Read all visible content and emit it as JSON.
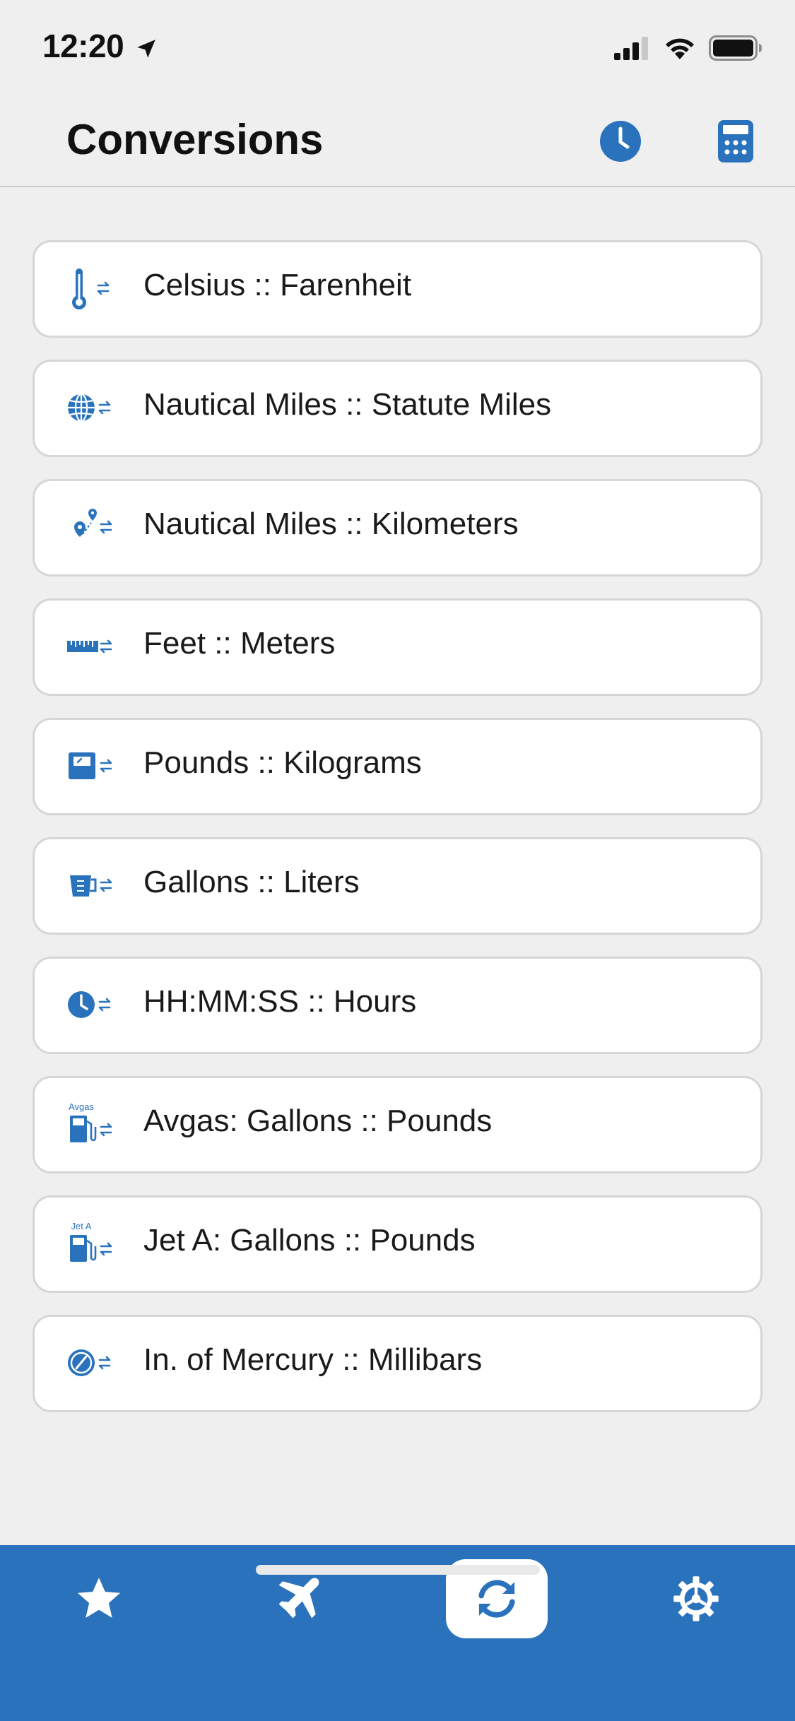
{
  "status_bar": {
    "time": "12:20",
    "icons": [
      "location-arrow-icon",
      "cellular-signal-icon",
      "wifi-icon",
      "battery-icon"
    ]
  },
  "header": {
    "title": "Conversions",
    "buttons": [
      {
        "name": "history",
        "icon": "clock-icon"
      },
      {
        "name": "calculator",
        "icon": "calculator-icon"
      }
    ]
  },
  "conversions": [
    {
      "label": "Celsius :: Farenheit",
      "icon": "thermometer-swap-icon"
    },
    {
      "label": "Nautical Miles :: Statute Miles",
      "icon": "globe-swap-icon"
    },
    {
      "label": "Nautical Miles :: Kilometers",
      "icon": "route-pins-swap-icon"
    },
    {
      "label": "Feet :: Meters",
      "icon": "ruler-swap-icon"
    },
    {
      "label": "Pounds :: Kilograms",
      "icon": "scale-swap-icon"
    },
    {
      "label": "Gallons :: Liters",
      "icon": "measuring-cup-swap-icon"
    },
    {
      "label": "HH:MM:SS :: Hours",
      "icon": "clock-swap-icon"
    },
    {
      "label": "Avgas: Gallons :: Pounds",
      "icon": "fuel-pump-swap-icon",
      "badge": "Avgas"
    },
    {
      "label": "Jet A: Gallons :: Pounds",
      "icon": "fuel-pump-swap-icon",
      "badge": "Jet A"
    },
    {
      "label": "In. of Mercury :: Millibars",
      "icon": "barometer-swap-icon"
    }
  ],
  "tabbar": {
    "tabs": [
      {
        "name": "favorites",
        "icon": "star-icon",
        "active": false
      },
      {
        "name": "flight",
        "icon": "airplane-icon",
        "active": false
      },
      {
        "name": "conversions",
        "icon": "refresh-icon",
        "active": true
      },
      {
        "name": "settings",
        "icon": "gear-icon",
        "active": false
      }
    ]
  },
  "colors": {
    "accent": "#2a73bc",
    "background": "#efefef",
    "card": "#ffffff",
    "card_border": "#d6d6d6"
  }
}
